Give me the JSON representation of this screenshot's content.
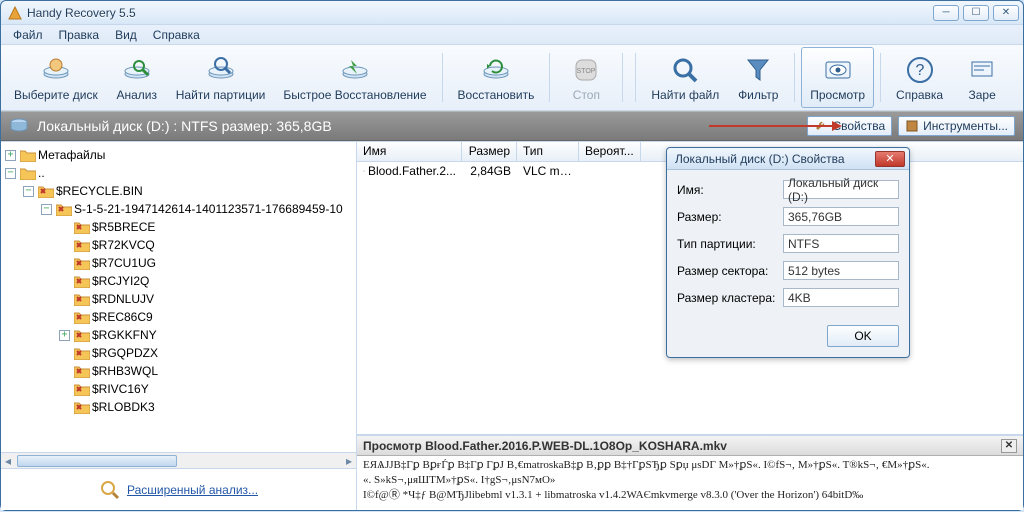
{
  "titlebar": {
    "title": "Handy Recovery 5.5"
  },
  "menus": [
    "Файл",
    "Правка",
    "Вид",
    "Справка"
  ],
  "toolbar": [
    {
      "label": "Выберите диск",
      "icon": "disk-select",
      "enabled": true
    },
    {
      "label": "Анализ",
      "icon": "disk-analyze",
      "enabled": true
    },
    {
      "label": "Найти партиции",
      "icon": "disk-partition",
      "enabled": true
    },
    {
      "label": "Быстрое Восстановление",
      "icon": "disk-quick",
      "enabled": true
    },
    {
      "label": "Восстановить",
      "icon": "disk-recover",
      "enabled": true
    },
    {
      "label": "Стоп",
      "icon": "stop",
      "enabled": false
    },
    {
      "label": "Найти файл",
      "icon": "find",
      "enabled": true
    },
    {
      "label": "Фильтр",
      "icon": "filter",
      "enabled": true
    },
    {
      "label": "Просмотр",
      "icon": "preview",
      "enabled": true,
      "active": true
    },
    {
      "label": "Справка",
      "icon": "help",
      "enabled": true
    },
    {
      "label": "Заре",
      "icon": "register",
      "enabled": true
    }
  ],
  "drive_strip": {
    "text": "Локальный диск (D:) : NTFS размер: 365,8GB",
    "btn_props": "Свойства",
    "btn_tools": "Инструменты..."
  },
  "tree": {
    "root": "Метафайлы",
    "dots": "..",
    "recycle": "$RECYCLE.BIN",
    "sid": "S-1-5-21-1947142614-1401123571-176689459-10",
    "children": [
      "$R5BRECE",
      "$R72KVCQ",
      "$R7CU1UG",
      "$RCJYI2Q",
      "$RDNLUJV",
      "$REC86C9",
      "$RGKKFNY",
      "$RGQPDZX",
      "$RHB3WQL",
      "$RIVC16Y",
      "$RLOBDK3"
    ]
  },
  "adv_link": "Расширенный анализ...",
  "list": {
    "headers": [
      "Имя",
      "Размер",
      "Тип",
      "Вероят..."
    ],
    "row": {
      "name": "Blood.Father.2...",
      "size": "2,84GB",
      "type": "VLC me...",
      "prob": ""
    }
  },
  "preview": {
    "title": "Просмотр Blood.Father.2016.P.WEB-DL.1O8Op_KOSHARA.mkv",
    "lines": [
      "EЯѦJJB‡Гꝑ  BꝑғЃꝑ B‡Гꝑ  ГꝑJ B‚€matroskaB‡ꝑ B‚ꝑꝑ B‡†ГꝑSЂꝑ  Sꝑџ   μsDГ  M»†ꝑS«. I©fS¬‚   M»†ꝑS«. T®kS¬‚   €M»†ꝑS«.",
      "«. S»kS¬‚μᴙШТM»†ꝑS«. I†gS¬‚μsN7мO»",
      "I©f@Ⓡ *Ч‡ƒ B@MЂJlibebml v1.3.1 + libmatroska v1.4.2WAЄmkvmerge v8.3.0 ('Over the Horizon') 64bitD‰"
    ]
  },
  "dialog": {
    "title": "Локальный диск (D:)  Свойства",
    "rows": [
      {
        "label": "Имя:",
        "value": "Локальный диск (D:)"
      },
      {
        "label": "Размер:",
        "value": "365,76GB"
      },
      {
        "label": "Тип партиции:",
        "value": "NTFS"
      },
      {
        "label": "Размер сектора:",
        "value": "512 bytes"
      },
      {
        "label": "Размер кластера:",
        "value": "4KB"
      }
    ],
    "ok": "OK"
  }
}
